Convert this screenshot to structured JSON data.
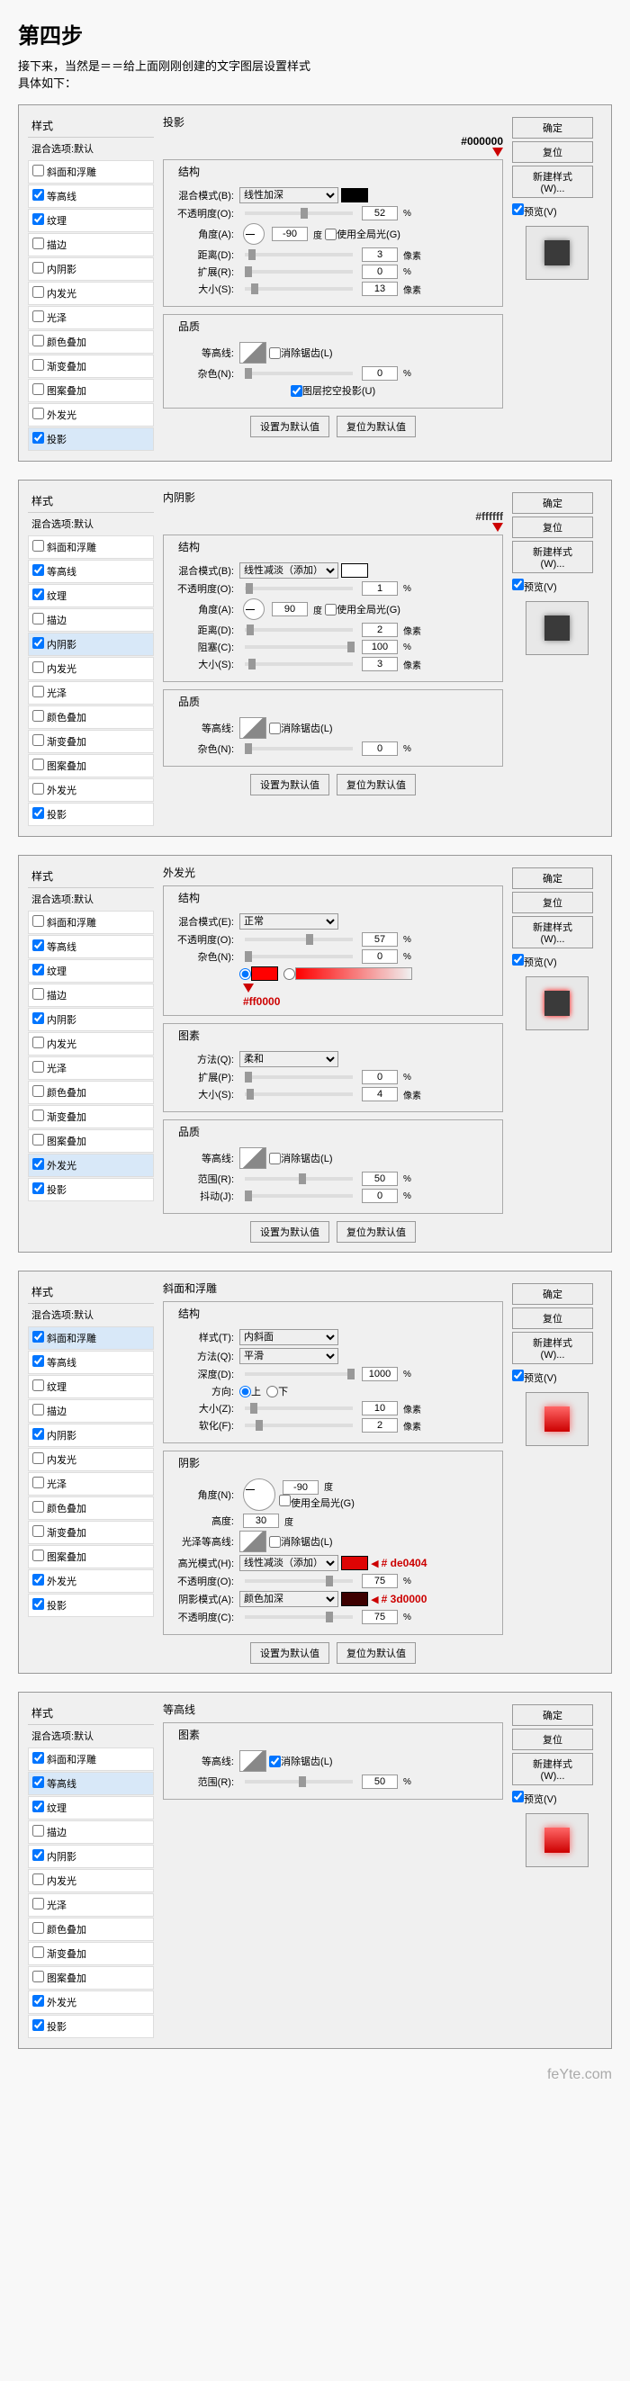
{
  "header": {
    "step": "第四步",
    "desc": "接下来，当然是＝＝给上面刚刚创建的文字图层设置样式\n具体如下：",
    "desc2": "具体如下："
  },
  "common": {
    "styles_title": "样式",
    "blend_default": "混合选项:默认",
    "ok": "确定",
    "cancel": "复位",
    "new_style": "新建样式(W)...",
    "preview": "预览(V)",
    "set_default": "设置为默认值",
    "reset_default": "复位为默认值",
    "style_items": [
      "斜面和浮雕",
      "等高线",
      "纹理",
      "描边",
      "内阴影",
      "内发光",
      "光泽",
      "颜色叠加",
      "渐变叠加",
      "图案叠加",
      "外发光",
      "投影"
    ]
  },
  "panel1": {
    "title": "投影",
    "hex": "#000000",
    "struct": "结构",
    "blend_mode": "混合模式(B):",
    "blend_val": "线性加深",
    "opacity": "不透明度(O):",
    "opacity_val": "52",
    "opacity_u": "%",
    "angle": "角度(A):",
    "angle_val": "-90",
    "angle_u": "度",
    "global": "使用全局光(G)",
    "distance": "距离(D):",
    "distance_val": "3",
    "distance_u": "像素",
    "spread": "扩展(R):",
    "spread_val": "0",
    "spread_u": "%",
    "size": "大小(S):",
    "size_val": "13",
    "size_u": "像素",
    "quality": "品质",
    "contour": "等高线:",
    "anti": "消除锯齿(L)",
    "noise": "杂色(N):",
    "noise_val": "0",
    "noise_u": "%",
    "knockout": "图层挖空投影(U)"
  },
  "panel2": {
    "title": "内阴影",
    "hex": "#ffffff",
    "struct": "结构",
    "blend_mode": "混合模式(B):",
    "blend_val": "线性减淡（添加）",
    "opacity": "不透明度(O):",
    "opacity_val": "1",
    "opacity_u": "%",
    "angle": "角度(A):",
    "angle_val": "90",
    "angle_u": "度",
    "global": "使用全局光(G)",
    "distance": "距离(D):",
    "distance_val": "2",
    "distance_u": "像素",
    "choke": "阻塞(C):",
    "choke_val": "100",
    "choke_u": "%",
    "size": "大小(S):",
    "size_val": "3",
    "size_u": "像素",
    "quality": "品质",
    "contour": "等高线:",
    "anti": "消除锯齿(L)",
    "noise": "杂色(N):",
    "noise_val": "0",
    "noise_u": "%"
  },
  "panel3": {
    "title": "外发光",
    "hex": "#ff0000",
    "struct": "结构",
    "blend_mode": "混合模式(E):",
    "blend_val": "正常",
    "opacity": "不透明度(O):",
    "opacity_val": "57",
    "opacity_u": "%",
    "noise": "杂色(N):",
    "noise_val": "0",
    "noise_u": "%",
    "elements": "图素",
    "method": "方法(Q):",
    "method_val": "柔和",
    "spread": "扩展(P):",
    "spread_val": "0",
    "spread_u": "%",
    "size": "大小(S):",
    "size_val": "4",
    "size_u": "像素",
    "quality": "品质",
    "contour": "等高线:",
    "anti": "消除锯齿(L)",
    "range": "范围(R):",
    "range_val": "50",
    "range_u": "%",
    "jitter": "抖动(J):",
    "jitter_val": "0",
    "jitter_u": "%"
  },
  "panel4": {
    "title": "斜面和浮雕",
    "hex1": "# de0404",
    "hex2": "# 3d0000",
    "struct": "结构",
    "style": "样式(T):",
    "style_val": "内斜面",
    "method": "方法(Q):",
    "method_val": "平滑",
    "depth": "深度(D):",
    "depth_val": "1000",
    "depth_u": "%",
    "direction": "方向:",
    "dir_up": "上",
    "dir_down": "下",
    "size": "大小(Z):",
    "size_val": "10",
    "size_u": "像素",
    "soften": "软化(F):",
    "soften_val": "2",
    "soften_u": "像素",
    "shading": "阴影",
    "angle": "角度(N):",
    "angle_val": "-90",
    "angle_u": "度",
    "global": "使用全局光(G)",
    "altitude": "高度:",
    "altitude_val": "30",
    "altitude_u": "度",
    "gloss": "光泽等高线:",
    "anti": "消除锯齿(L)",
    "hmode": "高光模式(H):",
    "hmode_val": "线性减淡（添加）",
    "hopacity": "不透明度(O):",
    "hopacity_val": "75",
    "hopacity_u": "%",
    "smode": "阴影模式(A):",
    "smode_val": "颜色加深",
    "sopacity": "不透明度(C):",
    "sopacity_val": "75",
    "sopacity_u": "%"
  },
  "panel5": {
    "title": "等高线",
    "elements": "图素",
    "contour": "等高线:",
    "anti": "消除锯齿(L)",
    "range": "范围(R):",
    "range_val": "50",
    "range_u": "%"
  },
  "footer": "feYte.com"
}
